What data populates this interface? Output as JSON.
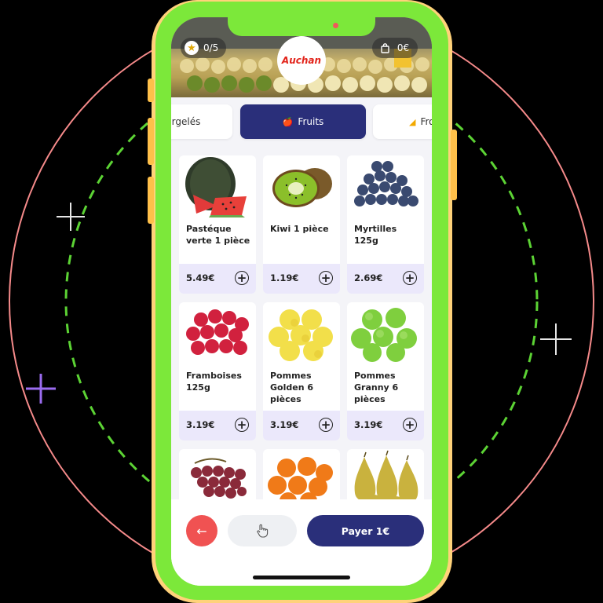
{
  "header": {
    "stars": "0/5",
    "logo_text": "Auchan",
    "cart_total": "0€"
  },
  "categories": [
    {
      "label": "rgelés",
      "icon": ""
    },
    {
      "label": "Fruits",
      "icon": "apple-icon",
      "active": true
    },
    {
      "label": "Fro",
      "icon": "cheese-icon"
    }
  ],
  "products": [
    {
      "name": "Pastéque verte 1 pièce",
      "price": "5.49€",
      "icon": "watermelon"
    },
    {
      "name": "Kiwi 1 pièce",
      "price": "1.19€",
      "icon": "kiwi"
    },
    {
      "name": "Myrtilles 125g",
      "price": "2.69€",
      "icon": "blueberries"
    },
    {
      "name": "Framboises 125g",
      "price": "3.19€",
      "icon": "raspberries"
    },
    {
      "name": "Pommes Golden 6 pièces",
      "price": "3.19€",
      "icon": "golden-apples"
    },
    {
      "name": "Pommes Granny 6 pièces",
      "price": "3.19€",
      "icon": "granny-apples"
    },
    {
      "name": "",
      "price": "",
      "icon": "grapes"
    },
    {
      "name": "",
      "price": "",
      "icon": "mandarins"
    },
    {
      "name": "",
      "price": "",
      "icon": "pears"
    }
  ],
  "footer": {
    "back_icon": "←",
    "pay_label": "Payer 1€"
  },
  "colors": {
    "phone_frame": "#7ce83a",
    "primary": "#2a2f7a",
    "back_button": "#f05252",
    "price_bar": "#ebe8fb"
  }
}
